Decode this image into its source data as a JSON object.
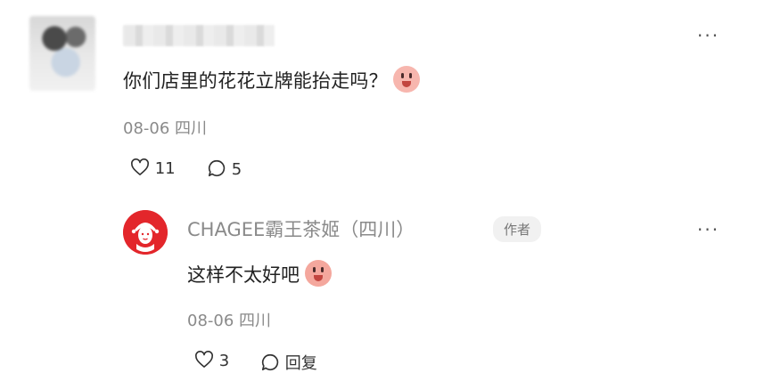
{
  "comment": {
    "username": "",
    "text": "你们店里的花花立牌能抬走吗？",
    "emoji": "laughing-tears-emoji",
    "date": "08-06",
    "location": "四川",
    "likes": "11",
    "replies": "5"
  },
  "reply": {
    "username": "CHAGEE霸王茶姬（四川）",
    "badge": "作者",
    "text": "这样不太好吧",
    "emoji": "pray-emoji",
    "date": "08-06",
    "location": "四川",
    "likes": "3",
    "reply_label": "回复"
  },
  "more_label": "···",
  "colors": {
    "brand_red": "#e3262b",
    "meta_gray": "#8a8a8a"
  }
}
